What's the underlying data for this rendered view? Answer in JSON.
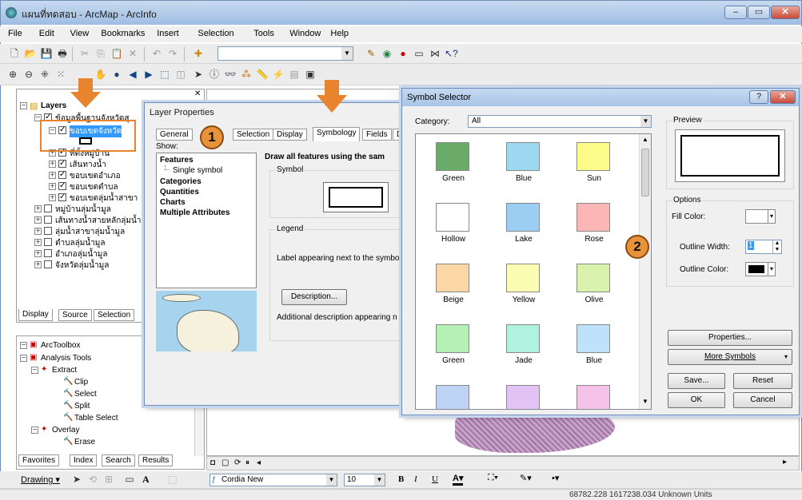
{
  "app": {
    "title": "แผนที่ทดสอบ - ArcMap - ArcInfo",
    "controls": {
      "minimize": "–",
      "maximize": "▭",
      "close": "✕"
    }
  },
  "menu": {
    "items": [
      "File",
      "Edit",
      "View",
      "Bookmarks",
      "Insert",
      "Selection",
      "Tools",
      "Window",
      "Help"
    ]
  },
  "toolbar": {
    "scale_value": "",
    "draw_label": "Drawing ▾",
    "font_name": "Cordia New",
    "font_size": "10",
    "bold": "B",
    "italic": "I",
    "underline": "U",
    "text_tool": "A"
  },
  "toc": {
    "root": "Layers",
    "group": "ข้อมูลพื้นฐานจังหวัดสุ…",
    "items": [
      {
        "label": "ขอบเขตจังหวัด",
        "checked": true,
        "selected": true
      },
      {
        "label": "ที่ตั้งหมู่บ้าน",
        "checked": true
      },
      {
        "label": "เส้นทางน้ำ",
        "checked": true
      },
      {
        "label": "ขอบเขตอำเภอ",
        "checked": true
      },
      {
        "label": "ขอบเขตตำบล",
        "checked": true
      },
      {
        "label": "ขอบเขตลุ่มน้ำสาขา",
        "checked": true
      },
      {
        "label": "หมู่บ้านลุ่มน้ำมูล",
        "checked": false
      },
      {
        "label": "เส้นทางน้ำสายหลักลุ่มน้ำ",
        "checked": false
      },
      {
        "label": "ลุ่มน้ำสาขาลุ่มน้ำมูล",
        "checked": false
      },
      {
        "label": "ตำบลลุ่มน้ำมูล",
        "checked": false
      },
      {
        "label": "อำเภอลุ่มน้ำมูล",
        "checked": false
      },
      {
        "label": "จังหวัดลุ่มน้ำมูล",
        "checked": false
      }
    ],
    "tabs": [
      "Display",
      "Source",
      "Selection"
    ]
  },
  "toolbox": {
    "root": "ArcToolbox",
    "items": [
      "Analysis Tools",
      "Extract",
      "Clip",
      "Select",
      "Split",
      "Table Select",
      "Overlay",
      "Erase"
    ],
    "tabs": [
      "Favorites",
      "Index",
      "Search",
      "Results"
    ]
  },
  "layer_props": {
    "title": "Layer Properties",
    "tabs": [
      "General",
      "Selection",
      "Display",
      "Symbology",
      "Fields",
      "D"
    ],
    "show_label": "Show:",
    "show_items": [
      "Features",
      "Single symbol",
      "Categories",
      "Quantities",
      "Charts",
      "Multiple Attributes"
    ],
    "heading": "Draw all features using the sam",
    "symbol_label": "Symbol",
    "legend_label": "Legend",
    "legend_text": "Label appearing next to the symbo",
    "description_button": "Description...",
    "additional_text": "Additional description appearing n"
  },
  "symbol_selector": {
    "title": "Symbol Selector",
    "help": "?",
    "close": "✕",
    "category_label": "Category:",
    "category_value": "All",
    "swatches": [
      {
        "label": "Green",
        "color": "#6aab6a"
      },
      {
        "label": "Blue",
        "color": "#9ed7f0"
      },
      {
        "label": "Sun",
        "color": "#fcfc8a"
      },
      {
        "label": "Hollow",
        "color": "#ffffff"
      },
      {
        "label": "Lake",
        "color": "#9ccdf2"
      },
      {
        "label": "Rose",
        "color": "#fbb6b6"
      },
      {
        "label": "Beige",
        "color": "#fcd7a6"
      },
      {
        "label": "Yellow",
        "color": "#fcfcb2"
      },
      {
        "label": "Olive",
        "color": "#d9f2ad"
      },
      {
        "label": "Green",
        "color": "#b5f0b5"
      },
      {
        "label": "Jade",
        "color": "#b0f2e0"
      },
      {
        "label": "Blue",
        "color": "#bfe2fb"
      },
      {
        "label": "",
        "color": "#bfd3f7"
      },
      {
        "label": "",
        "color": "#e3c3f5"
      },
      {
        "label": "",
        "color": "#f5c3ea"
      }
    ],
    "preview_label": "Preview",
    "options_label": "Options",
    "fill_color_label": "Fill Color:",
    "outline_width_label": "Outline Width:",
    "outline_width_value": "1",
    "outline_color_label": "Outline Color:",
    "properties_button": "Properties...",
    "more_symbols_button": "More Symbols",
    "save_button": "Save...",
    "reset_button": "Reset",
    "ok_button": "OK",
    "cancel_button": "Cancel"
  },
  "annotations": {
    "badge1": "1",
    "badge2": "2"
  },
  "status": {
    "coords": "68782.228  1617238.034 Unknown Units"
  }
}
